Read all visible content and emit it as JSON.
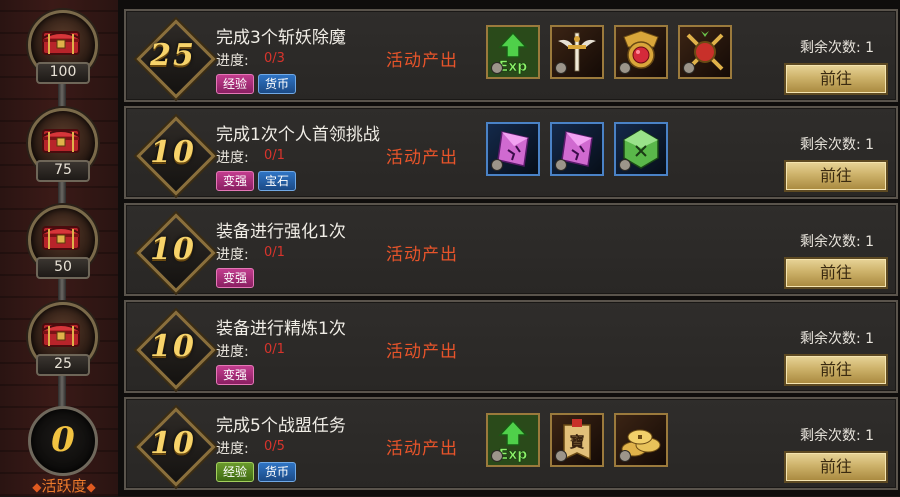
{
  "sidebar": {
    "milestones": [
      "100",
      "75",
      "50",
      "25"
    ],
    "current_activity": "0",
    "activity_label": "活跃度"
  },
  "tasks": [
    {
      "points": "25",
      "title": "完成3个斩妖除魔",
      "progress_label": "进度:",
      "progress": "0/3",
      "tags": [
        {
          "text": "经验",
          "color": "pink"
        },
        {
          "text": "货币",
          "color": "blue"
        }
      ],
      "source": "活动产出",
      "rewards": [
        "exp-potion-icon",
        "winged-sword-emblem-icon",
        "ruby-medal-icon",
        "crossed-swords-crest-icon"
      ],
      "remaining": "剩余次数: 1",
      "button": "前往"
    },
    {
      "points": "10",
      "title": "完成1次个人首领挑战",
      "progress_label": "进度:",
      "progress": "0/1",
      "tags": [
        {
          "text": "变强",
          "color": "pink"
        },
        {
          "text": "宝石",
          "color": "blue"
        }
      ],
      "source": "活动产出",
      "rewards": [
        "pink-gem-icon",
        "pink-gem-icon",
        "green-gem-icon"
      ],
      "remaining": "剩余次数: 1",
      "button": "前往"
    },
    {
      "points": "10",
      "title": "装备进行强化1次",
      "progress_label": "进度:",
      "progress": "0/1",
      "tags": [
        {
          "text": "变强",
          "color": "pink"
        }
      ],
      "source": "活动产出",
      "rewards": [],
      "remaining": "剩余次数: 1",
      "button": "前往"
    },
    {
      "points": "10",
      "title": "装备进行精炼1次",
      "progress_label": "进度:",
      "progress": "0/1",
      "tags": [
        {
          "text": "变强",
          "color": "pink"
        }
      ],
      "source": "活动产出",
      "rewards": [],
      "remaining": "剩余次数: 1",
      "button": "前往"
    },
    {
      "points": "10",
      "title": "完成5个战盟任务",
      "progress_label": "进度:",
      "progress": "0/5",
      "tags": [
        {
          "text": "经验",
          "color": "green"
        },
        {
          "text": "货币",
          "color": "blue"
        }
      ],
      "source": "活动产出",
      "rewards": [
        "exp-potion-icon",
        "tribute-token-icon",
        "coin-pile-icon"
      ],
      "remaining": "剩余次数: 1",
      "button": "前往"
    }
  ],
  "reward_badge_text": "寶",
  "colors": {
    "progress_red": "#d8342c",
    "source_orange": "#e8542a",
    "points_gold": "#f7d36a",
    "activity_orange": "#ec7a2c"
  }
}
